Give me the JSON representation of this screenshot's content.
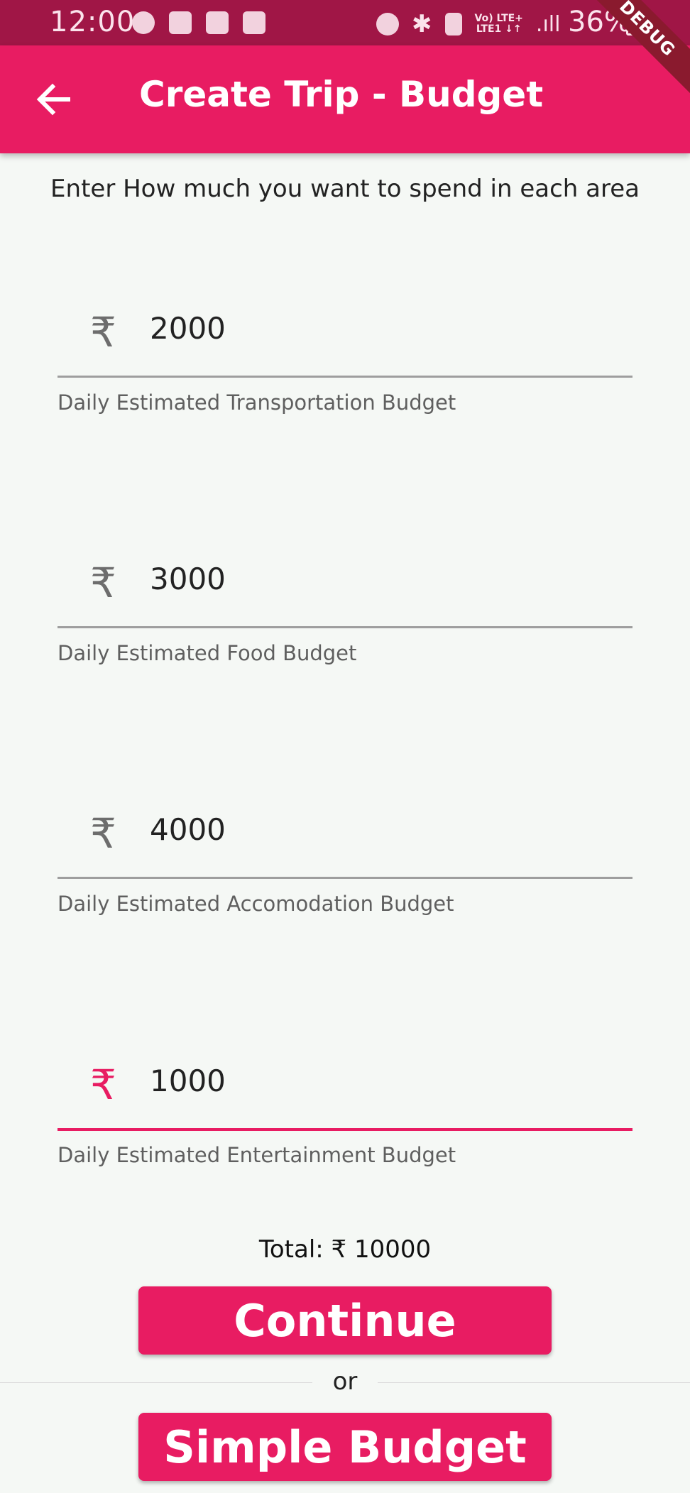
{
  "status": {
    "time": "12:00",
    "network": [
      "Vo) LTE+",
      "LTE1 ↓↑"
    ],
    "battery": "36%",
    "debug": "DEBUG"
  },
  "app_bar": {
    "title": "Create Trip - Budget",
    "back_icon": "arrow-back-icon"
  },
  "instruction": "Enter How much you want to spend in each area",
  "currency_symbol": "₹",
  "fields": [
    {
      "value": "2000",
      "label": "Daily Estimated Transportation Budget"
    },
    {
      "value": "3000",
      "label": "Daily Estimated Food Budget"
    },
    {
      "value": "4000",
      "label": "Daily Estimated Accomodation Budget"
    },
    {
      "value": "1000",
      "label": "Daily Estimated Entertainment Budget"
    }
  ],
  "total": "Total: ₹ 10000",
  "buttons": {
    "continue": "Continue",
    "or": "or",
    "simple_budget": "Simple Budget"
  },
  "colors": {
    "primary": "#e81c62",
    "status_bar": "#a01646",
    "background": "#f5f8f5"
  }
}
